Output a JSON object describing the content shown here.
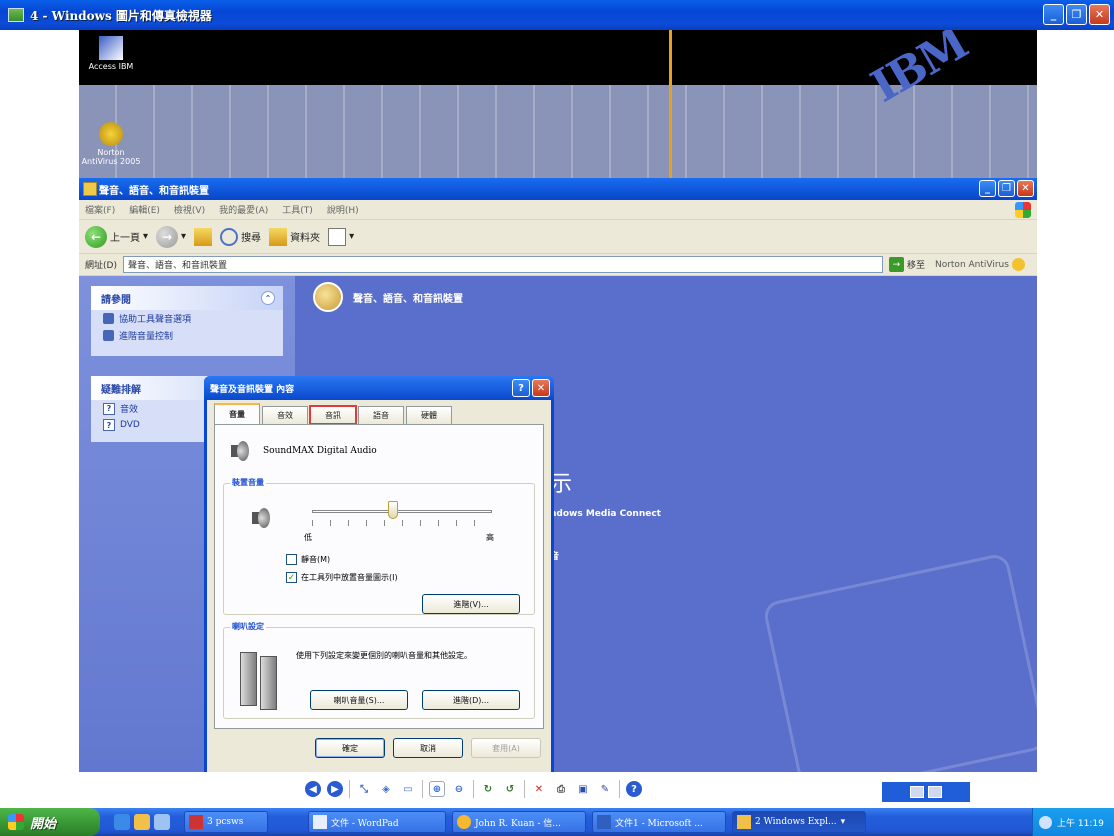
{
  "viewer": {
    "title": "4 - Windows 圖片和傳真檢視器",
    "min_label": "_",
    "max_label": "❐",
    "close_label": "✕"
  },
  "desktop": {
    "icon1_label": "Access IBM",
    "icon2_label": "Norton AntiVirus 2005",
    "ibm_logo": "IBM"
  },
  "explorer": {
    "title": "聲音、語音、和音訊裝置",
    "menus": [
      "檔案(F)",
      "編輯(E)",
      "檢視(V)",
      "我的最愛(A)",
      "工具(T)",
      "說明(H)"
    ],
    "toolbar": {
      "back": "上一頁",
      "search": "搜尋",
      "folders": "資料夾"
    },
    "address_label": "網址(D)",
    "address_value": "聲音、語音、和音訊裝置",
    "go_label": "移至",
    "norton_label": "Norton AntiVirus",
    "left_panel": {
      "see_also_title": "請參閱",
      "see_also_items": [
        "協助工具聲音選項",
        "進階音量控制"
      ],
      "troubleshoot_title": "疑難排解",
      "troubleshoot_items": [
        "音效",
        "DVD"
      ]
    },
    "main_header": "聲音、語音、和音訊裝置",
    "main_text1": "示",
    "main_text2": "ndows Media Connect",
    "main_text3": "音"
  },
  "dialog": {
    "title": "聲音及音訊裝置 內容",
    "help_label": "?",
    "close_label": "✕",
    "tabs": [
      "音量",
      "音效",
      "音訊",
      "語音",
      "硬體"
    ],
    "device_name": "SoundMAX Digital Audio",
    "device_volume_label": "裝置音量",
    "volume_level_percent": 45,
    "low_label": "低",
    "high_label": "高",
    "mute_label": "靜音(M)",
    "mute_checked": false,
    "tray_icon_label": "在工具列中放置音量圖示(I)",
    "tray_icon_checked": true,
    "advanced_label": "進階(V)...",
    "speaker_settings_label": "喇叭設定",
    "speaker_desc": "使用下列設定來變更個別的喇叭音量和其他設定。",
    "speaker_volume_btn": "喇叭音量(S)...",
    "speaker_advanced_btn": "進階(D)...",
    "ok_label": "確定",
    "cancel_label": "取消",
    "apply_label": "套用(A)"
  },
  "taskbar": {
    "start_label": "開始",
    "tasks": [
      "3 pcsws",
      "文件 - WordPad",
      "John R. Kuan - 信...",
      "文件1 - Microsoft ...",
      "2 Windows Expl..."
    ],
    "clock": "上午 11:19"
  }
}
